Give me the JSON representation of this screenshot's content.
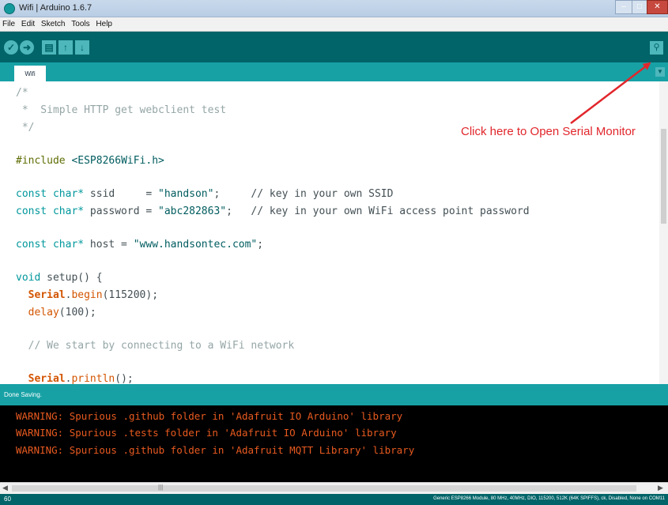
{
  "window": {
    "title": "Wifi | Arduino 1.6.7"
  },
  "menu": [
    "File",
    "Edit",
    "Sketch",
    "Tools",
    "Help"
  ],
  "toolbar": {
    "verify_icon": "check-icon",
    "upload_icon": "arrow-right-icon",
    "new_icon": "new-file-icon",
    "open_icon": "arrow-up-icon",
    "save_icon": "arrow-down-icon",
    "serial_monitor_icon": "magnifier-icon"
  },
  "tabs": [
    {
      "label": "Wifi"
    }
  ],
  "code_lines": {
    "l1": "/*",
    "l2": " *  Simple HTTP get webclient test",
    "l3": " */",
    "l5_pp": "#include ",
    "l5_lib": "<ESP8266WiFi.h>",
    "l7_kw": "const char*",
    "l7_id": " ssid     = ",
    "l7_str": "\"handson\"",
    "l7_end": ";",
    "l7_cmt": "     // key in your own SSID",
    "l8_kw": "const char*",
    "l8_id": " password = ",
    "l8_str": "\"abc282863\"",
    "l8_end": ";",
    "l8_cmt": "   // key in your own WiFi access point password",
    "l10_kw": "const char*",
    "l10_id": " host = ",
    "l10_str": "\"www.handsontec.com\"",
    "l10_end": ";",
    "l12_kw": "void",
    "l12_fn": " setup",
    "l12_end": "() {",
    "l13_cls": "  Serial",
    "l13_dot": ".",
    "l13_fn": "begin",
    "l13_end": "(115200);",
    "l14_fn": "  delay",
    "l14_end": "(100);",
    "l16_cmt": "  // We start by connecting to a WiFi network",
    "l18_cls": "  Serial",
    "l18_dot": ".",
    "l18_fn": "println",
    "l18_end": "();"
  },
  "annotation": {
    "text": "Click here to Open Serial Monitor",
    "color": "#e1262b"
  },
  "status": {
    "message": "Done Saving."
  },
  "console_lines": [
    "WARNING: Spurious .github folder in 'Adafruit IO Arduino' library",
    "WARNING: Spurious .tests folder in 'Adafruit IO Arduino' library",
    "WARNING: Spurious .github folder in 'Adafruit MQTT Library' library"
  ],
  "footer": {
    "line_number": "60",
    "board_info": "Generic ESP8266 Module, 80 MHz, 40MHz, DIO, 115200, 512K (64K SPIFFS), ck, Disabled, None on COM11"
  },
  "colors": {
    "toolbar": "#006468",
    "tab_row": "#17a1a5",
    "console_text": "#e85a20",
    "annotation": "#e1262b"
  }
}
